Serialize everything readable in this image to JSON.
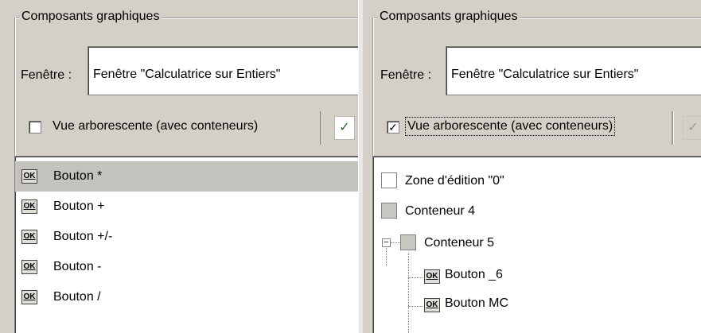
{
  "left_panel": {
    "group_title": "Composants graphiques",
    "window_label": "Fenêtre :",
    "window_value": "Fenêtre \"Calculatrice sur Entiers\"",
    "tree_view": {
      "label": "Vue arborescente (avec conteneurs)",
      "checked": false
    },
    "list_items": [
      {
        "icon": "ok-button-icon",
        "icon_text": "OK",
        "label": "Bouton *",
        "selected": true
      },
      {
        "icon": "ok-button-icon",
        "icon_text": "OK",
        "label": "Bouton +",
        "selected": false
      },
      {
        "icon": "ok-button-icon",
        "icon_text": "OK",
        "label": "Bouton +/-",
        "selected": false
      },
      {
        "icon": "ok-button-icon",
        "icon_text": "OK",
        "label": "Bouton -",
        "selected": false
      },
      {
        "icon": "ok-button-icon",
        "icon_text": "OK",
        "label": "Bouton /",
        "selected": false
      }
    ]
  },
  "right_panel": {
    "group_title": "Composants graphiques",
    "window_label": "Fenêtre :",
    "window_value": "Fenêtre \"Calculatrice sur Entiers\"",
    "tree_view": {
      "label": "Vue arborescente (avec conteneurs)",
      "checked": true,
      "check_mark": "✓"
    },
    "tree_items": [
      {
        "icon": "edit-zone-icon",
        "label": "Zone d'édition \"0\""
      },
      {
        "icon": "container-icon",
        "label": "Conteneur 4"
      },
      {
        "icon": "container-icon",
        "label": "Conteneur 5",
        "expander": "−"
      },
      {
        "icon": "ok-button-icon",
        "icon_text": "OK",
        "label": "Bouton _6"
      },
      {
        "icon": "ok-button-icon",
        "icon_text": "OK",
        "label": "Bouton MC"
      }
    ]
  },
  "colors": {
    "panel_bg": "#d4d0c8",
    "selection_bg": "#c4c2bd",
    "list_bg": "#ffffff"
  }
}
